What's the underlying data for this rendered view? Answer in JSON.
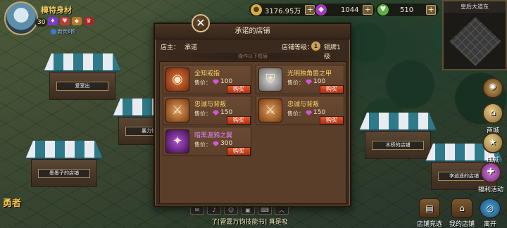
{
  "player": {
    "name": "模特身材",
    "level": "30",
    "rank": "新兵6阶"
  },
  "currency": {
    "gold": "3176.95万",
    "gems": "1044",
    "hearts": "510"
  },
  "minimap": {
    "title": "皇后大道东"
  },
  "stalls": [
    {
      "label": "爱室出"
    },
    {
      "label": "暴力怪物"
    },
    {
      "label": "墨墨子的店铺"
    },
    {
      "label": "木桥的店铺"
    },
    {
      "label": "李逍遥的店铺"
    }
  ],
  "side_buttons": {
    "shop": "商城",
    "achieve": "成就",
    "welfare": "福利活动"
  },
  "bottom_buttons": {
    "shop_compete": "店铺竞选",
    "my_shop": "我的店铺",
    "leave": "离开"
  },
  "hero_label": "勇者",
  "chat": {
    "text": "了[雷霆万钧技能书] 真是吸"
  },
  "shop": {
    "title": "承诺的店铺",
    "owner_label": "店主：",
    "owner_name": "承诺",
    "level_label": "店铺等级：",
    "level_num": "1",
    "level_name": "铜牌1级",
    "hint": "操作以下框层",
    "price_label": "售价：",
    "buy_label": "购买",
    "items": [
      {
        "name": "全知戒指",
        "price": "100",
        "rarity": "gold"
      },
      {
        "name": "光明独角兽之甲",
        "price": "100",
        "rarity": "gold"
      },
      {
        "name": "忠诚与背叛",
        "price": "150",
        "rarity": "gold"
      },
      {
        "name": "忠诚与背叛",
        "price": "150",
        "rarity": "gold"
      },
      {
        "name": "暗黑渡鸦之翼",
        "price": "300",
        "rarity": "purple"
      }
    ]
  },
  "colors": {
    "accent_gold": "#f5d36a",
    "accent_purple": "#e088ff",
    "buy_button": "#e8582a",
    "panel": "#3a2a1e"
  },
  "icons": [
    "ring-icon",
    "armor-icon",
    "sword-icon",
    "sword-icon",
    "wings-icon"
  ]
}
